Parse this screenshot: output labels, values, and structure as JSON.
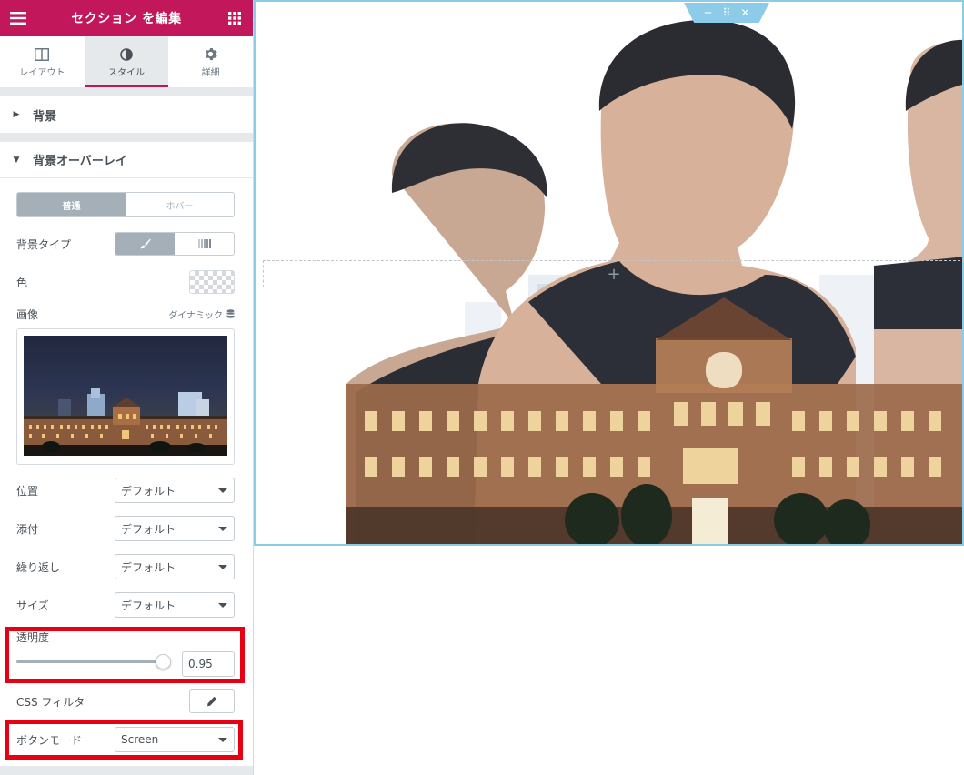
{
  "header": {
    "title": "セクション を編集"
  },
  "tabs": [
    {
      "label": "レイアウト"
    },
    {
      "label": "スタイル"
    },
    {
      "label": "詳細"
    }
  ],
  "sections": {
    "background": {
      "label": "背景"
    },
    "overlay": {
      "label": "背景オーバーレイ"
    }
  },
  "state_toggle": {
    "normal": "普通",
    "hover": "ホバー"
  },
  "bg_type": {
    "label": "背景タイプ"
  },
  "color": {
    "label": "色"
  },
  "image": {
    "label": "画像",
    "dynamic": "ダイナミック"
  },
  "position": {
    "label": "位置",
    "value": "デフォルト"
  },
  "attachment": {
    "label": "添付",
    "value": "デフォルト"
  },
  "repeat": {
    "label": "繰り返し",
    "value": "デフォルト"
  },
  "size": {
    "label": "サイズ",
    "value": "デフォルト"
  },
  "opacity": {
    "label": "透明度",
    "value": "0.95",
    "level": 0.95
  },
  "css_filter": {
    "label": "CSS フィルタ"
  },
  "blend_mode": {
    "label": "ボタンモード",
    "value": "Screen"
  },
  "colors": {
    "brand": "#c2175b",
    "highlight": "#e60012",
    "section_border": "#8ccce9"
  }
}
